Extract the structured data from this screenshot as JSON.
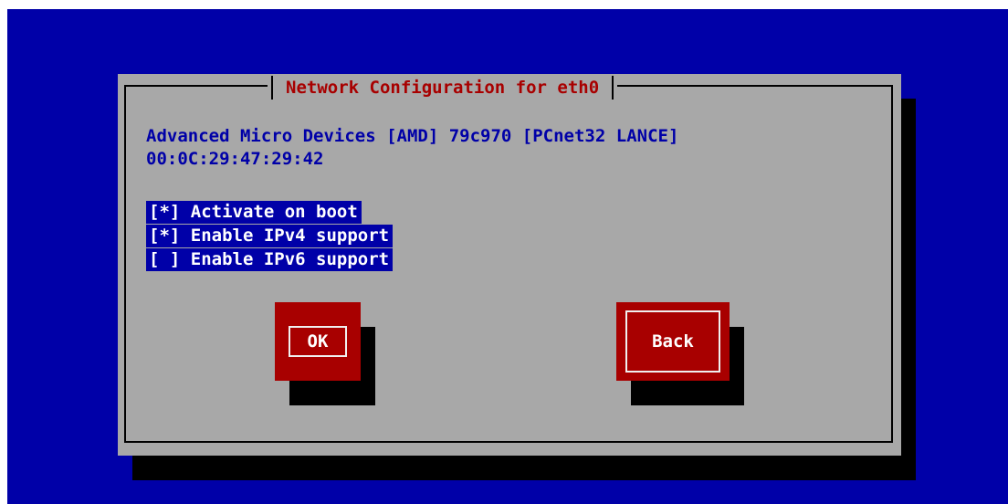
{
  "dialog": {
    "title": "Network Configuration for eth0",
    "device_name": "Advanced Micro Devices [AMD] 79c970 [PCnet32 LANCE]",
    "mac_address": "00:0C:29:47:29:42"
  },
  "options": [
    {
      "label": "[*] Activate on boot",
      "checked": true
    },
    {
      "label": "[*] Enable IPv4 support",
      "checked": true
    },
    {
      "label": "[ ] Enable IPv6 support",
      "checked": false
    }
  ],
  "buttons": {
    "ok_label": "OK",
    "back_label": "Back"
  },
  "colors": {
    "screen_bg": "#0000a8",
    "dialog_bg": "#a8a8a8",
    "title_fg": "#a80000",
    "button_bg": "#a80000",
    "text_fg": "#0000a8",
    "highlight_bg": "#0000a8",
    "highlight_fg": "#ffffff"
  }
}
